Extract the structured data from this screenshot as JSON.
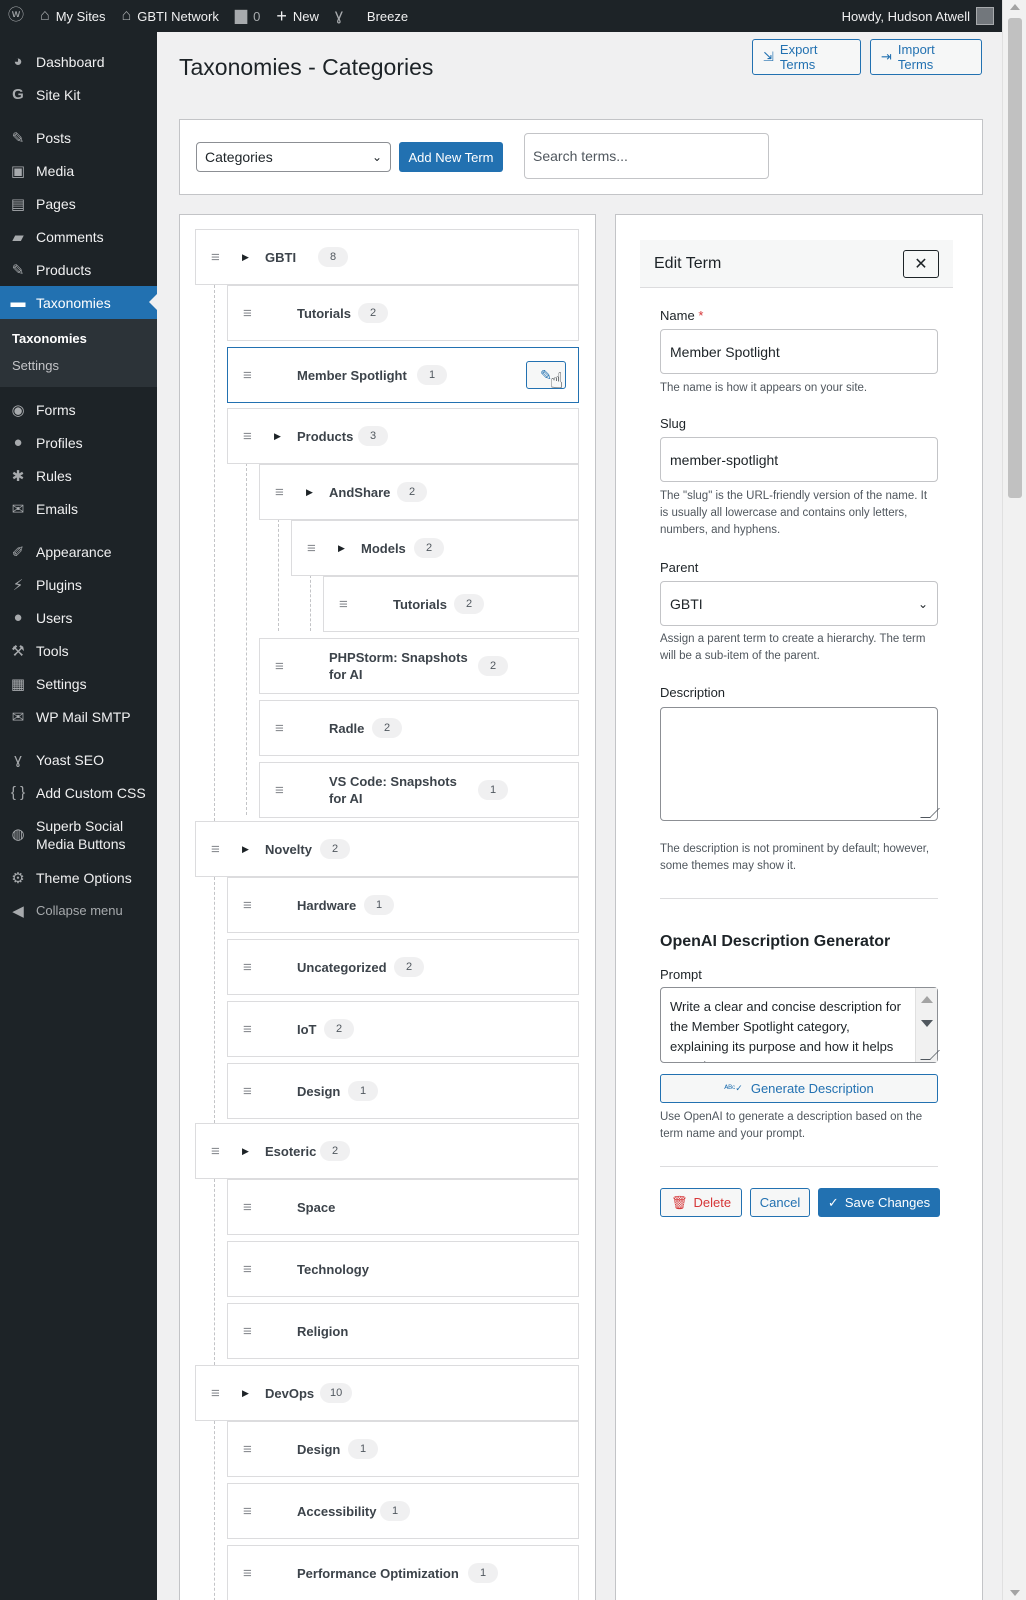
{
  "adminbar": {
    "my_sites": "My Sites",
    "site_name": "GBTI Network",
    "comments_count": "0",
    "new_label": "New",
    "breeze_label": "Breeze",
    "howdy": "Howdy, Hudson Atwell"
  },
  "sidebar": {
    "items": [
      {
        "label": "Dashboard",
        "icon": "dashboard-icon"
      },
      {
        "label": "Site Kit",
        "icon": "google-g-icon"
      },
      {
        "label": "Posts",
        "icon": "pin-icon"
      },
      {
        "label": "Media",
        "icon": "media-icon"
      },
      {
        "label": "Pages",
        "icon": "pages-icon"
      },
      {
        "label": "Comments",
        "icon": "comment-icon"
      },
      {
        "label": "Products",
        "icon": "pin-icon"
      },
      {
        "label": "Taxonomies",
        "icon": "folder-icon"
      },
      {
        "label": "Forms",
        "icon": "forms-icon"
      },
      {
        "label": "Profiles",
        "icon": "users-icon"
      },
      {
        "label": "Rules",
        "icon": "rules-icon"
      },
      {
        "label": "Emails",
        "icon": "envelope-icon"
      },
      {
        "label": "Appearance",
        "icon": "brush-icon"
      },
      {
        "label": "Plugins",
        "icon": "plugin-icon"
      },
      {
        "label": "Users",
        "icon": "user-icon"
      },
      {
        "label": "Tools",
        "icon": "wrench-icon"
      },
      {
        "label": "Settings",
        "icon": "settings-icon"
      },
      {
        "label": "WP Mail SMTP",
        "icon": "mail-smtp-icon"
      },
      {
        "label": "Yoast SEO",
        "icon": "yoast-icon"
      },
      {
        "label": "Add Custom CSS",
        "icon": "braces-icon"
      },
      {
        "label": "Superb Social Media Buttons",
        "icon": "social-icon"
      },
      {
        "label": "Theme Options",
        "icon": "gear-icon"
      },
      {
        "label": "Collapse menu",
        "icon": "collapse-icon"
      }
    ],
    "submenu": [
      "Taxonomies",
      "Settings"
    ]
  },
  "page": {
    "title": "Taxonomies - Categories",
    "export_label": "Export Terms",
    "import_label": "Import Terms"
  },
  "toolbar": {
    "taxonomy_selected": "Categories",
    "add_new_label": "Add New Term",
    "search_placeholder": "Search terms..."
  },
  "tree": [
    {
      "label": "GBTI",
      "count": "8"
    },
    {
      "label": "Tutorials",
      "count": "2"
    },
    {
      "label": "Member Spotlight",
      "count": "1"
    },
    {
      "label": "Products",
      "count": "3"
    },
    {
      "label": "AndShare",
      "count": "2"
    },
    {
      "label": "Models",
      "count": "2"
    },
    {
      "label": "Tutorials",
      "count": "2"
    },
    {
      "label": "PHPStorm: Snapshots for AI",
      "count": "2"
    },
    {
      "label": "Radle",
      "count": "2"
    },
    {
      "label": "VS Code: Snapshots for AI",
      "count": "1"
    },
    {
      "label": "Novelty",
      "count": "2"
    },
    {
      "label": "Hardware",
      "count": "1"
    },
    {
      "label": "Uncategorized",
      "count": "2"
    },
    {
      "label": "IoT",
      "count": "2"
    },
    {
      "label": "Design",
      "count": "1"
    },
    {
      "label": "Esoteric",
      "count": "2"
    },
    {
      "label": "Space",
      "count": ""
    },
    {
      "label": "Technology",
      "count": ""
    },
    {
      "label": "Religion",
      "count": ""
    },
    {
      "label": "DevOps",
      "count": "10"
    },
    {
      "label": "Design",
      "count": "1"
    },
    {
      "label": "Accessibility",
      "count": "1"
    },
    {
      "label": "Performance Optimization",
      "count": "1"
    }
  ],
  "edit": {
    "title": "Edit Term",
    "name_label": "Name",
    "required_mark": "*",
    "name_value": "Member Spotlight",
    "name_help": "The name is how it appears on your site.",
    "slug_label": "Slug",
    "slug_value": "member-spotlight",
    "slug_help": "The \"slug\" is the URL-friendly version of the name. It is usually all lowercase and contains only letters, numbers, and hyphens.",
    "parent_label": "Parent",
    "parent_value": "GBTI",
    "parent_help": "Assign a parent term to create a hierarchy. The term will be a sub-item of the parent.",
    "description_label": "Description",
    "description_value": "",
    "description_help": "The description is not prominent by default; however, some themes may show it.",
    "ai_title": "OpenAI Description Generator",
    "prompt_label": "Prompt",
    "prompt_value": "Write a clear and concise description for the Member Spotlight category, explaining its purpose and how it helps organize content.",
    "generate_label": "Generate Description",
    "generate_help": "Use OpenAI to generate a description based on the term name and your prompt.",
    "delete_label": "Delete",
    "cancel_label": "Cancel",
    "save_label": "Save Changes"
  }
}
